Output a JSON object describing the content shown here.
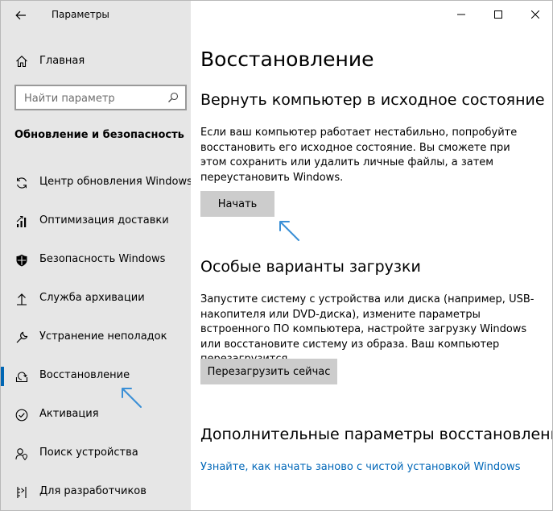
{
  "window": {
    "title": "Параметры",
    "controls": [
      "minimize",
      "maximize",
      "close"
    ]
  },
  "sidebar": {
    "home_label": "Главная",
    "search_placeholder": "Найти параметр",
    "section_title": "Обновление и безопасность",
    "items": [
      {
        "label": "Центр обновления Windows",
        "icon": "sync-icon"
      },
      {
        "label": "Оптимизация доставки",
        "icon": "delivery-icon"
      },
      {
        "label": "Безопасность Windows",
        "icon": "shield-icon"
      },
      {
        "label": "Служба архивации",
        "icon": "backup-arrow-icon"
      },
      {
        "label": "Устранение неполадок",
        "icon": "wrench-icon"
      },
      {
        "label": "Восстановление",
        "icon": "recovery-icon",
        "active": true
      },
      {
        "label": "Активация",
        "icon": "check-circle-icon"
      },
      {
        "label": "Поиск устройства",
        "icon": "person-location-icon"
      },
      {
        "label": "Для разработчиков",
        "icon": "developer-icon"
      }
    ]
  },
  "main": {
    "title": "Восстановление",
    "reset": {
      "heading": "Вернуть компьютер в исходное состояние",
      "description": "Если ваш компьютер работает нестабильно, попробуйте восстановить его исходное состояние. Вы сможете при этом сохранить или удалить личные файлы, а затем переустановить Windows.",
      "button": "Начать"
    },
    "advanced_startup": {
      "heading": "Особые варианты загрузки",
      "description": "Запустите систему с устройства или диска (например, USB-накопителя или DVD-диска), измените параметры встроенного ПО компьютера, настройте загрузку Windows или восстановите систему из образа. Ваш компьютер перезагрузится.",
      "button": "Перезагрузить сейчас"
    },
    "more": {
      "heading": "Дополнительные параметры восстановления",
      "link": "Узнайте, как начать заново с чистой установкой Windows"
    }
  },
  "colors": {
    "accent": "#0066b4",
    "link": "#0067b8",
    "sidebar_bg": "#e6e6e6",
    "button_bg": "#cccccc",
    "annotation_arrow": "#3a8fd6"
  }
}
